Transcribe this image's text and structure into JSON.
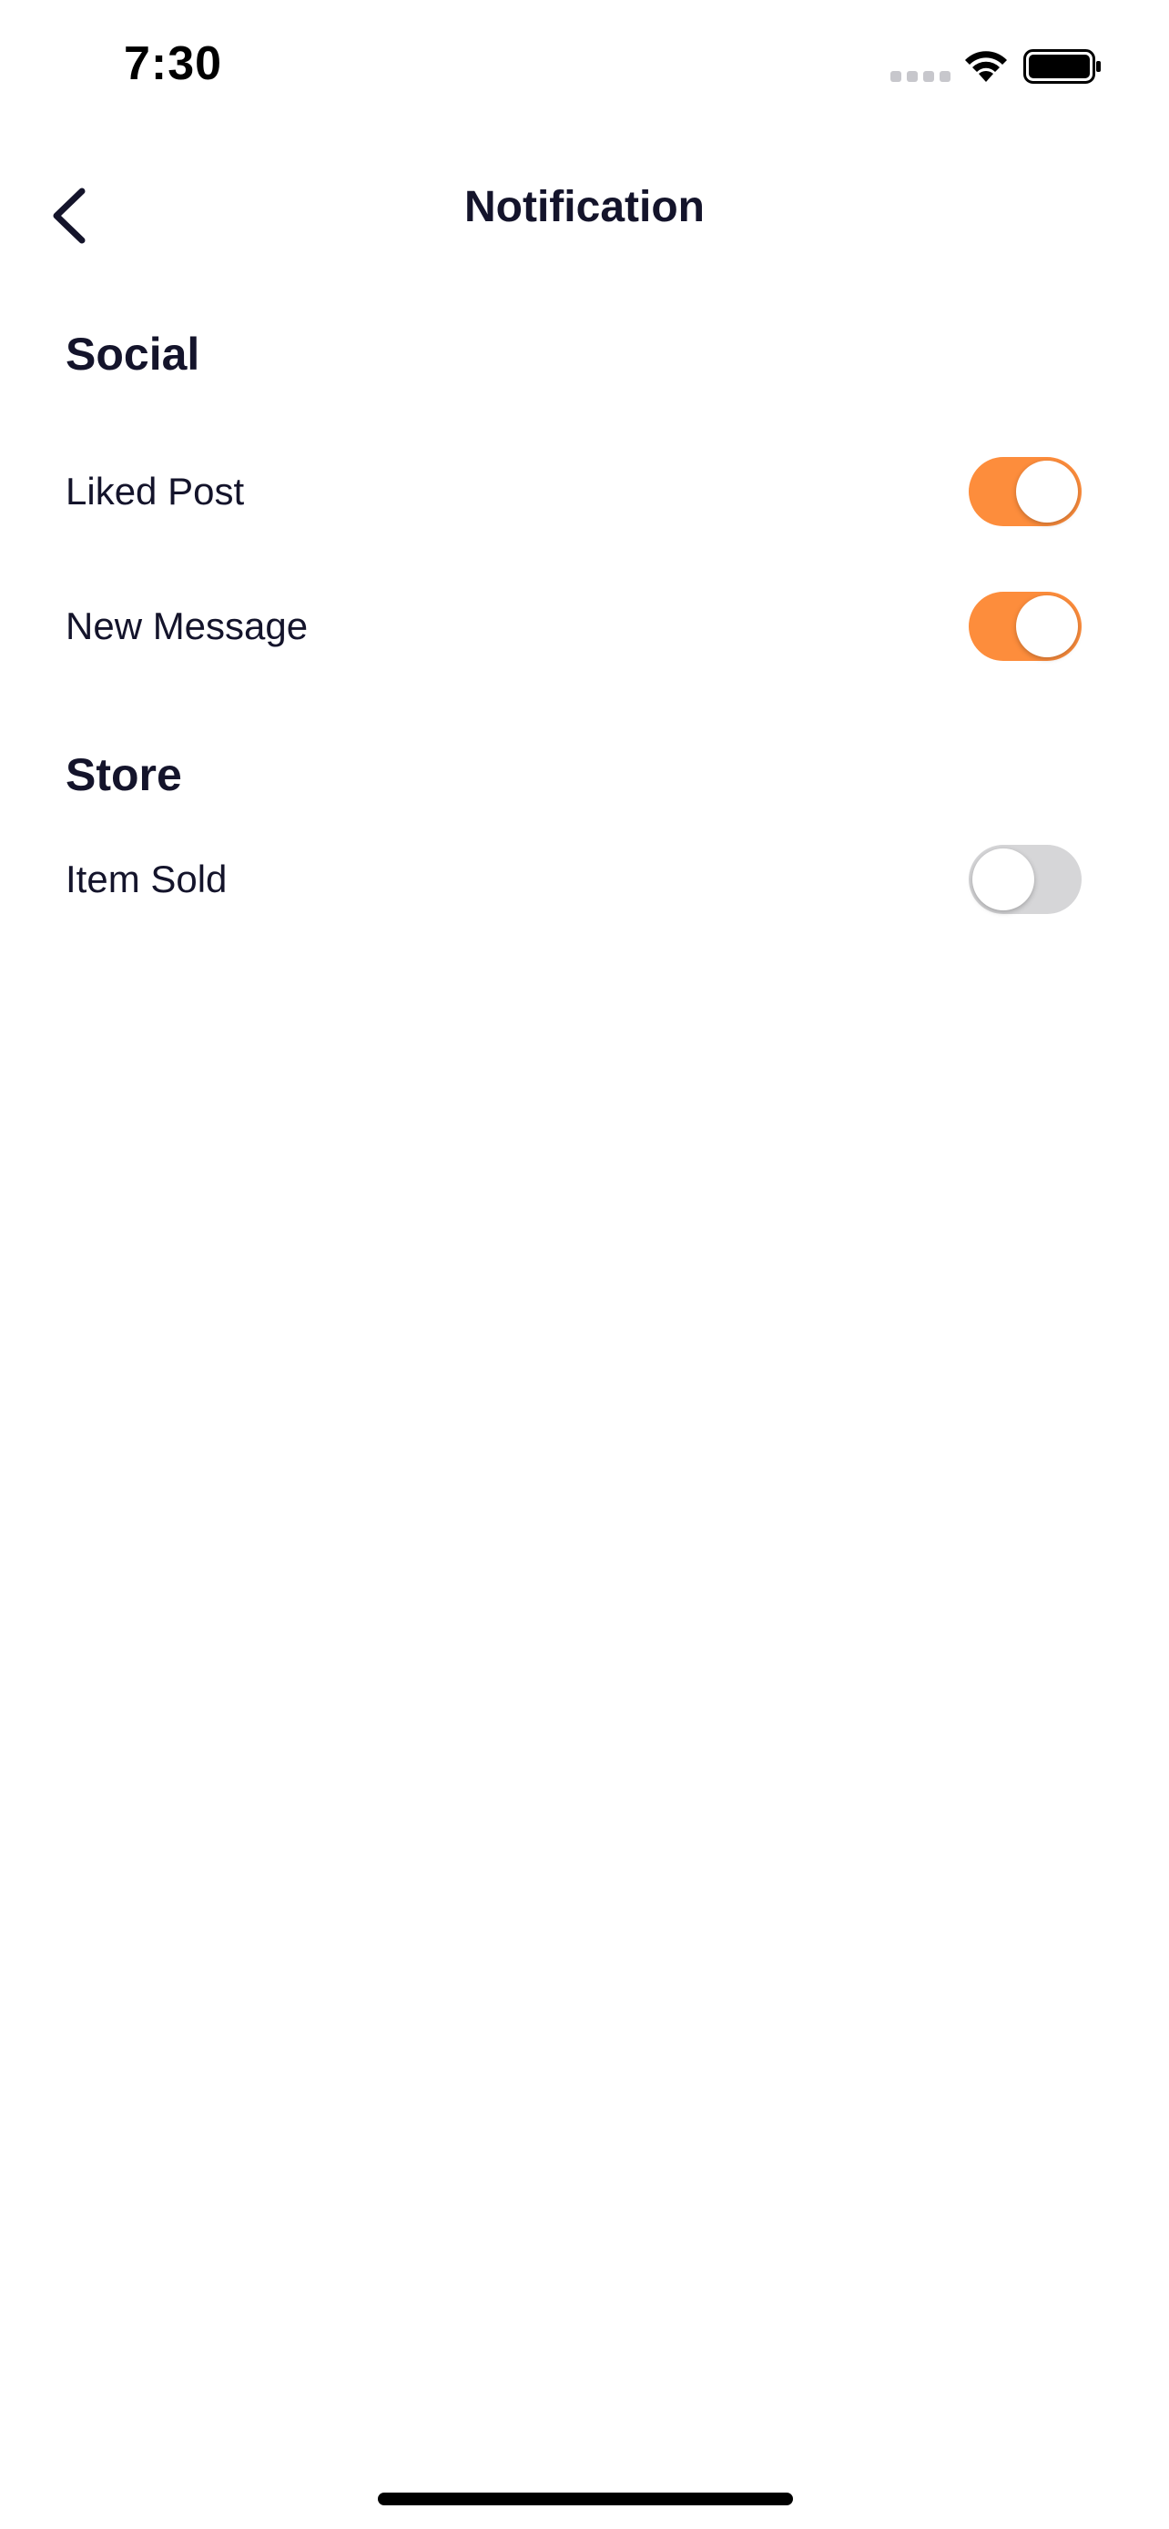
{
  "status_bar": {
    "time": "7:30"
  },
  "header": {
    "title": "Notification",
    "back_icon": "chevron-left-icon"
  },
  "sections": [
    {
      "title": "Social",
      "items": [
        {
          "label": "Liked Post",
          "enabled": true
        },
        {
          "label": "New Message",
          "enabled": true
        }
      ]
    },
    {
      "title": "Store",
      "items": [
        {
          "label": "Item Sold",
          "enabled": false
        }
      ]
    }
  ],
  "colors": {
    "accent": "#fd8d3c",
    "toggle_off": "#d6d6d8",
    "text": "#14142b"
  }
}
